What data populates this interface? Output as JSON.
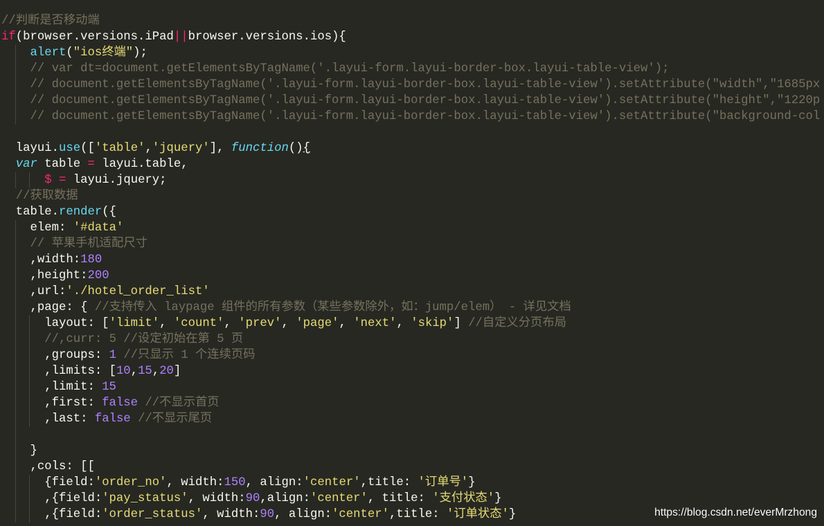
{
  "theme": {
    "background": "#272822",
    "guide": "#464741",
    "plain": "#f8f8f2",
    "comment": "#75715e",
    "string": "#e6db74",
    "number": "#ae81ff",
    "keyword": "#f92672",
    "support": "#66d9ef"
  },
  "editor": {
    "lines": [
      {
        "tokens": [
          {
            "text": "//判断是否移动端",
            "color": "#75715e"
          }
        ]
      },
      {
        "tokens": [
          {
            "text": "if",
            "color": "#f92672"
          },
          {
            "text": "(browser.versions.iPad",
            "color": "#f8f8f2"
          },
          {
            "text": "||",
            "color": "#f92672"
          },
          {
            "text": "browser.versions.ios){",
            "color": "#f8f8f2"
          }
        ]
      },
      {
        "tokens": [
          {
            "text": "    ",
            "color": "#f8f8f2"
          },
          {
            "text": "alert",
            "color": "#66d9ef"
          },
          {
            "text": "(",
            "color": "#f8f8f2"
          },
          {
            "text": "\"ios终端\"",
            "color": "#e6db74"
          },
          {
            "text": ");",
            "color": "#f8f8f2"
          }
        ]
      },
      {
        "tokens": [
          {
            "text": "    ",
            "color": "#f8f8f2"
          },
          {
            "text": "// var dt=document.getElementsByTagName('.layui-form.layui-border-box.layui-table-view');",
            "color": "#75715e"
          }
        ]
      },
      {
        "tokens": [
          {
            "text": "    ",
            "color": "#f8f8f2"
          },
          {
            "text": "// document.getElementsByTagName('.layui-form.layui-border-box.layui-table-view').setAttribute(\"width\",\"1685px",
            "color": "#75715e"
          }
        ]
      },
      {
        "tokens": [
          {
            "text": "    ",
            "color": "#f8f8f2"
          },
          {
            "text": "// document.getElementsByTagName('.layui-form.layui-border-box.layui-table-view').setAttribute(\"height\",\"1220p",
            "color": "#75715e"
          }
        ]
      },
      {
        "tokens": [
          {
            "text": "    ",
            "color": "#f8f8f2"
          },
          {
            "text": "// document.getElementsByTagName('.layui-form.layui-border-box.layui-table-view').setAttribute(\"background-col",
            "color": "#75715e"
          }
        ]
      },
      {
        "tokens": []
      },
      {
        "tokens": [
          {
            "text": "  layui.",
            "color": "#f8f8f2"
          },
          {
            "text": "use",
            "color": "#66d9ef"
          },
          {
            "text": "([",
            "color": "#f8f8f2"
          },
          {
            "text": "'table'",
            "color": "#e6db74"
          },
          {
            "text": ",",
            "color": "#f8f8f2"
          },
          {
            "text": "'jquery'",
            "color": "#e6db74"
          },
          {
            "text": "], ",
            "color": "#f8f8f2"
          },
          {
            "text": "function",
            "color": "#66d9ef",
            "italic": true
          },
          {
            "text": "()",
            "color": "#f8f8f2"
          },
          {
            "text": "{",
            "color": "#f8f8f2",
            "underline": true
          }
        ]
      },
      {
        "tokens": [
          {
            "text": "  ",
            "color": "#f8f8f2"
          },
          {
            "text": "var",
            "color": "#66d9ef",
            "italic": true
          },
          {
            "text": " table ",
            "color": "#f8f8f2"
          },
          {
            "text": "=",
            "color": "#f92672"
          },
          {
            "text": " layui.table,",
            "color": "#f8f8f2"
          }
        ]
      },
      {
        "tokens": [
          {
            "text": "      ",
            "color": "#f8f8f2"
          },
          {
            "text": "$ =",
            "color": "#f92672"
          },
          {
            "text": " layui.jquery;",
            "color": "#f8f8f2"
          }
        ]
      },
      {
        "tokens": [
          {
            "text": "  ",
            "color": "#f8f8f2"
          },
          {
            "text": "//获取数据",
            "color": "#75715e"
          }
        ]
      },
      {
        "tokens": [
          {
            "text": "  table.",
            "color": "#f8f8f2"
          },
          {
            "text": "render",
            "color": "#66d9ef"
          },
          {
            "text": "({",
            "color": "#f8f8f2"
          }
        ]
      },
      {
        "tokens": [
          {
            "text": "    elem: ",
            "color": "#f8f8f2"
          },
          {
            "text": "'#data'",
            "color": "#e6db74"
          }
        ]
      },
      {
        "tokens": [
          {
            "text": "    ",
            "color": "#f8f8f2"
          },
          {
            "text": "// 苹果手机适配尺寸",
            "color": "#75715e"
          }
        ]
      },
      {
        "tokens": [
          {
            "text": "    ,width:",
            "color": "#f8f8f2"
          },
          {
            "text": "180",
            "color": "#ae81ff"
          }
        ]
      },
      {
        "tokens": [
          {
            "text": "    ,height:",
            "color": "#f8f8f2"
          },
          {
            "text": "200",
            "color": "#ae81ff"
          }
        ]
      },
      {
        "tokens": [
          {
            "text": "    ,url:",
            "color": "#f8f8f2"
          },
          {
            "text": "'./hotel_order_list'",
            "color": "#e6db74"
          }
        ]
      },
      {
        "tokens": [
          {
            "text": "    ,page: { ",
            "color": "#f8f8f2"
          },
          {
            "text": "//支持传入 laypage 组件的所有参数（某些参数除外，如：jump/elem） - 详见文档",
            "color": "#75715e"
          }
        ]
      },
      {
        "tokens": [
          {
            "text": "      layout: [",
            "color": "#f8f8f2"
          },
          {
            "text": "'limit'",
            "color": "#e6db74"
          },
          {
            "text": ", ",
            "color": "#f8f8f2"
          },
          {
            "text": "'count'",
            "color": "#e6db74"
          },
          {
            "text": ", ",
            "color": "#f8f8f2"
          },
          {
            "text": "'prev'",
            "color": "#e6db74"
          },
          {
            "text": ", ",
            "color": "#f8f8f2"
          },
          {
            "text": "'page'",
            "color": "#e6db74"
          },
          {
            "text": ", ",
            "color": "#f8f8f2"
          },
          {
            "text": "'next'",
            "color": "#e6db74"
          },
          {
            "text": ", ",
            "color": "#f8f8f2"
          },
          {
            "text": "'skip'",
            "color": "#e6db74"
          },
          {
            "text": "] ",
            "color": "#f8f8f2"
          },
          {
            "text": "//自定义分页布局",
            "color": "#75715e"
          }
        ]
      },
      {
        "tokens": [
          {
            "text": "      ",
            "color": "#f8f8f2"
          },
          {
            "text": "//,curr: 5 //设定初始在第 5 页",
            "color": "#75715e"
          }
        ]
      },
      {
        "tokens": [
          {
            "text": "      ,groups: ",
            "color": "#f8f8f2"
          },
          {
            "text": "1",
            "color": "#ae81ff"
          },
          {
            "text": " ",
            "color": "#f8f8f2"
          },
          {
            "text": "//只显示 1 个连续页码",
            "color": "#75715e"
          }
        ]
      },
      {
        "tokens": [
          {
            "text": "      ,limits: [",
            "color": "#f8f8f2"
          },
          {
            "text": "10",
            "color": "#ae81ff"
          },
          {
            "text": ",",
            "color": "#f8f8f2"
          },
          {
            "text": "15",
            "color": "#ae81ff"
          },
          {
            "text": ",",
            "color": "#f8f8f2"
          },
          {
            "text": "20",
            "color": "#ae81ff"
          },
          {
            "text": "]",
            "color": "#f8f8f2"
          }
        ]
      },
      {
        "tokens": [
          {
            "text": "      ,limit: ",
            "color": "#f8f8f2"
          },
          {
            "text": "15",
            "color": "#ae81ff"
          }
        ]
      },
      {
        "tokens": [
          {
            "text": "      ,first: ",
            "color": "#f8f8f2"
          },
          {
            "text": "false",
            "color": "#ae81ff"
          },
          {
            "text": " ",
            "color": "#f8f8f2"
          },
          {
            "text": "//不显示首页",
            "color": "#75715e"
          }
        ]
      },
      {
        "tokens": [
          {
            "text": "      ,last: ",
            "color": "#f8f8f2"
          },
          {
            "text": "false",
            "color": "#ae81ff"
          },
          {
            "text": " ",
            "color": "#f8f8f2"
          },
          {
            "text": "//不显示尾页",
            "color": "#75715e"
          }
        ]
      },
      {
        "tokens": []
      },
      {
        "tokens": [
          {
            "text": "    }",
            "color": "#f8f8f2"
          }
        ]
      },
      {
        "tokens": [
          {
            "text": "    ,cols: [[",
            "color": "#f8f8f2"
          }
        ]
      },
      {
        "tokens": [
          {
            "text": "      {field:",
            "color": "#f8f8f2"
          },
          {
            "text": "'order_no'",
            "color": "#e6db74"
          },
          {
            "text": ", width:",
            "color": "#f8f8f2"
          },
          {
            "text": "150",
            "color": "#ae81ff"
          },
          {
            "text": ", align:",
            "color": "#f8f8f2"
          },
          {
            "text": "'center'",
            "color": "#e6db74"
          },
          {
            "text": ",title: ",
            "color": "#f8f8f2"
          },
          {
            "text": "'订单号'",
            "color": "#e6db74"
          },
          {
            "text": "}",
            "color": "#f8f8f2"
          }
        ]
      },
      {
        "tokens": [
          {
            "text": "      ,{field:",
            "color": "#f8f8f2"
          },
          {
            "text": "'pay_status'",
            "color": "#e6db74"
          },
          {
            "text": ", width:",
            "color": "#f8f8f2"
          },
          {
            "text": "90",
            "color": "#ae81ff"
          },
          {
            "text": ",align:",
            "color": "#f8f8f2"
          },
          {
            "text": "'center'",
            "color": "#e6db74"
          },
          {
            "text": ", title: ",
            "color": "#f8f8f2"
          },
          {
            "text": "'支付状态'",
            "color": "#e6db74"
          },
          {
            "text": "}",
            "color": "#f8f8f2"
          }
        ]
      },
      {
        "tokens": [
          {
            "text": "      ,{field:",
            "color": "#f8f8f2"
          },
          {
            "text": "'order_status'",
            "color": "#e6db74"
          },
          {
            "text": ", width:",
            "color": "#f8f8f2"
          },
          {
            "text": "90",
            "color": "#ae81ff"
          },
          {
            "text": ", align:",
            "color": "#f8f8f2"
          },
          {
            "text": "'center'",
            "color": "#e6db74"
          },
          {
            "text": ",title: ",
            "color": "#f8f8f2"
          },
          {
            "text": "'订单状态'",
            "color": "#e6db74"
          },
          {
            "text": "}",
            "color": "#f8f8f2"
          }
        ]
      }
    ]
  },
  "watermark": {
    "text": "https://blog.csdn.net/everMrzhong",
    "color": "#ffffff"
  }
}
